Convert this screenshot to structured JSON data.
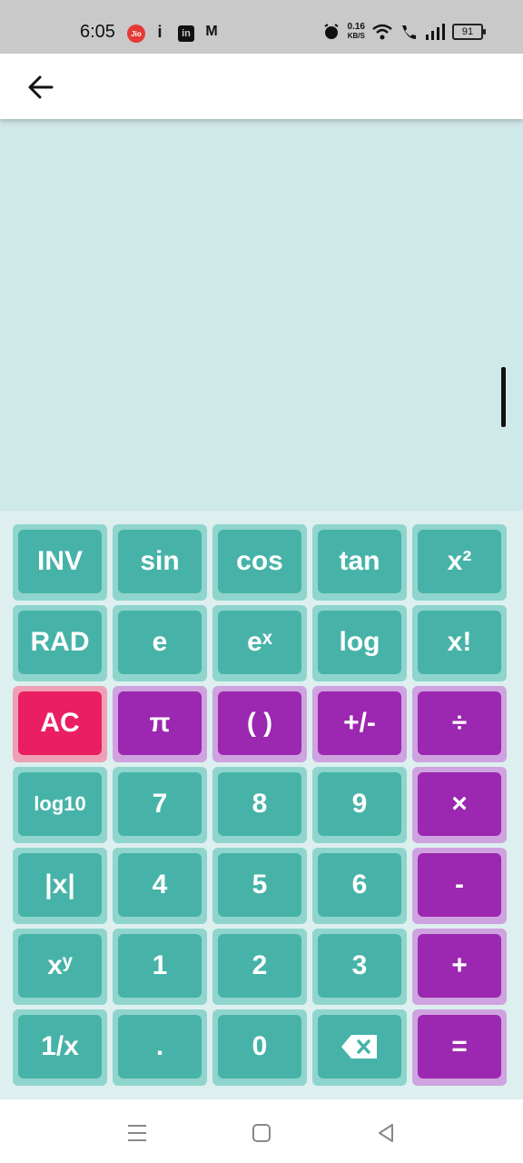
{
  "status_bar": {
    "time": "6:05",
    "jio_label": "Jio",
    "network_speed_value": "0.16",
    "network_speed_unit": "KB/S",
    "battery": "91"
  },
  "app_bar": {
    "back_icon": "arrow-left-icon"
  },
  "display": {
    "expression": "",
    "result": ""
  },
  "keys": [
    {
      "id": "inv",
      "label": "INV",
      "style": "teal"
    },
    {
      "id": "sin",
      "label": "sin",
      "style": "teal"
    },
    {
      "id": "cos",
      "label": "cos",
      "style": "teal"
    },
    {
      "id": "tan",
      "label": "tan",
      "style": "teal"
    },
    {
      "id": "square",
      "label": "x²",
      "style": "teal"
    },
    {
      "id": "rad",
      "label": "RAD",
      "style": "teal"
    },
    {
      "id": "e",
      "label": "e",
      "style": "teal"
    },
    {
      "id": "exp",
      "label": "eˣ",
      "style": "teal"
    },
    {
      "id": "log",
      "label": "log",
      "style": "teal"
    },
    {
      "id": "factorial",
      "label": "x!",
      "style": "teal"
    },
    {
      "id": "ac",
      "label": "AC",
      "style": "pink"
    },
    {
      "id": "pi",
      "label": "π",
      "style": "purple"
    },
    {
      "id": "parentheses",
      "label": "( )",
      "style": "purple"
    },
    {
      "id": "plus-minus",
      "label": "+/-",
      "style": "purple"
    },
    {
      "id": "divide",
      "label": "÷",
      "style": "purple"
    },
    {
      "id": "log10",
      "label": "log10",
      "style": "teal"
    },
    {
      "id": "7",
      "label": "7",
      "style": "teal"
    },
    {
      "id": "8",
      "label": "8",
      "style": "teal"
    },
    {
      "id": "9",
      "label": "9",
      "style": "teal"
    },
    {
      "id": "multiply",
      "label": "×",
      "style": "purple"
    },
    {
      "id": "abs",
      "label": "|x|",
      "style": "teal"
    },
    {
      "id": "4",
      "label": "4",
      "style": "teal"
    },
    {
      "id": "5",
      "label": "5",
      "style": "teal"
    },
    {
      "id": "6",
      "label": "6",
      "style": "teal"
    },
    {
      "id": "minus",
      "label": "-",
      "style": "purple"
    },
    {
      "id": "power",
      "label": "xʸ",
      "style": "teal"
    },
    {
      "id": "1",
      "label": "1",
      "style": "teal"
    },
    {
      "id": "2",
      "label": "2",
      "style": "teal"
    },
    {
      "id": "3",
      "label": "3",
      "style": "teal"
    },
    {
      "id": "plus",
      "label": "+",
      "style": "purple"
    },
    {
      "id": "reciprocal",
      "label": "1/x",
      "style": "teal"
    },
    {
      "id": "decimal",
      "label": ".",
      "style": "teal"
    },
    {
      "id": "0",
      "label": "0",
      "style": "teal"
    },
    {
      "id": "backspace",
      "label": "",
      "icon": "backspace-icon",
      "style": "teal"
    },
    {
      "id": "equals",
      "label": "=",
      "style": "purple"
    }
  ],
  "nav_bar": {
    "menu_icon": "menu-icon",
    "home_icon": "home-icon",
    "back_icon": "back-triangle-icon"
  },
  "colors": {
    "display_bg": "#cfe8e8",
    "key_teal": "#47b3a8",
    "key_purple": "#9c27b0",
    "key_pink": "#ea1f63"
  }
}
